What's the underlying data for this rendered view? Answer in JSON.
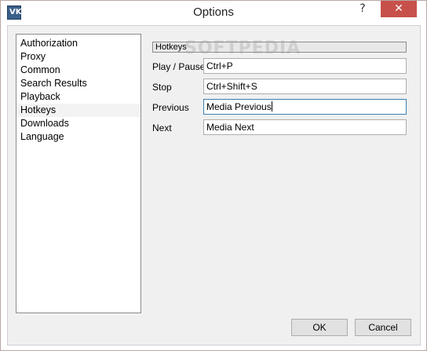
{
  "window": {
    "title": "Options",
    "icon_text": "VK",
    "help_label": "?",
    "close_label": "✕"
  },
  "nav": {
    "items": [
      {
        "label": "Authorization",
        "selected": false
      },
      {
        "label": "Proxy",
        "selected": false
      },
      {
        "label": "Common",
        "selected": false
      },
      {
        "label": "Search Results",
        "selected": false
      },
      {
        "label": "Playback",
        "selected": false
      },
      {
        "label": "Hotkeys",
        "selected": true
      },
      {
        "label": "Downloads",
        "selected": false
      },
      {
        "label": "Language",
        "selected": false
      }
    ]
  },
  "hotkeys": {
    "section_title": "Hotkeys",
    "watermark": "SOFTPEDIA",
    "rows": [
      {
        "label": "Play / Pause",
        "value": "Ctrl+P"
      },
      {
        "label": "Stop",
        "value": "Ctrl+Shift+S"
      },
      {
        "label": "Previous",
        "value": "Media Previous"
      },
      {
        "label": "Next",
        "value": "Media Next"
      }
    ]
  },
  "buttons": {
    "ok": "OK",
    "cancel": "Cancel"
  },
  "colors": {
    "close_button": "#c7504a",
    "focused_border": "#3c7fb1"
  }
}
